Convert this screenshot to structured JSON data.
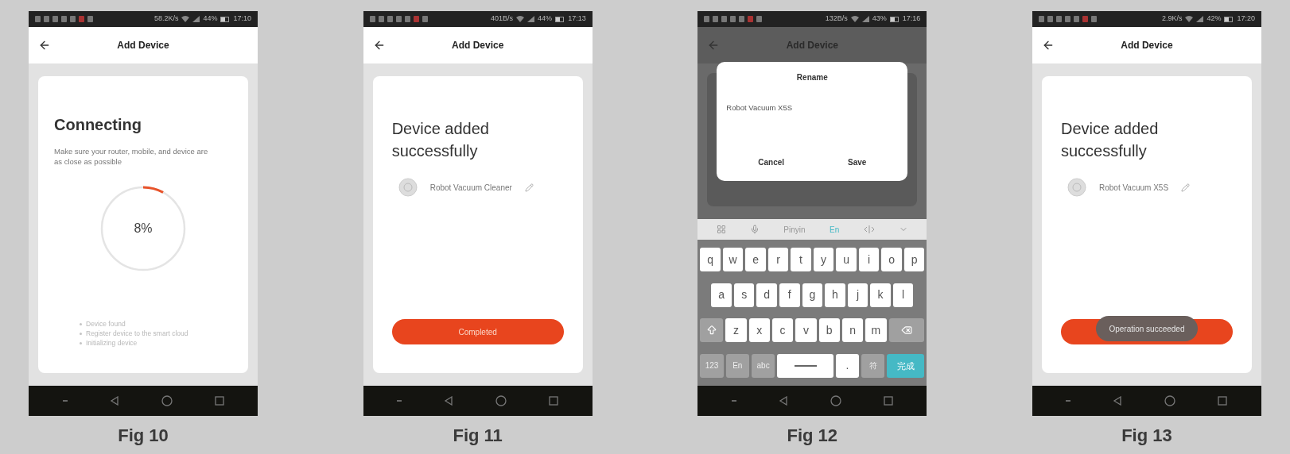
{
  "figures": [
    {
      "caption": "Fig 10",
      "status_bar": {
        "speed": "58.2K/s",
        "battery": "44%",
        "time": "17:10"
      },
      "app_bar": {
        "title": "Add Device",
        "dimmed": false
      },
      "screen": {
        "kind": "connecting",
        "title": "Connecting",
        "hint": "Make sure your router, mobile, and device are as close as possible",
        "progress": {
          "level": 0.08,
          "reading": "8%"
        },
        "steps": [
          "Device found",
          "Register device to the smart cloud",
          "Initializing device"
        ]
      }
    },
    {
      "caption": "Fig 11",
      "status_bar": {
        "speed": "401B/s",
        "battery": "44%",
        "time": "17:13"
      },
      "app_bar": {
        "title": "Add Device",
        "dimmed": false
      },
      "screen": {
        "kind": "added",
        "title": "Device added successfully",
        "device": "Robot Vacuum Cleaner",
        "button": {
          "kind": "primary",
          "label": "Completed"
        }
      }
    },
    {
      "caption": "Fig 12",
      "status_bar": {
        "speed": "132B/s",
        "battery": "43%",
        "time": "17:16"
      },
      "app_bar": {
        "title": "Add Device",
        "dimmed": true
      },
      "screen": {
        "kind": "rename",
        "dialog": {
          "title": "Rename",
          "value": "Robot Vacuum X5S",
          "buttons": [
            "Cancel",
            "Save"
          ]
        },
        "keyboard": {
          "toolbar": [
            {
              "kind": "grid"
            },
            {
              "kind": "mic"
            },
            {
              "kind": "text",
              "label": "Pinyin",
              "selected": false
            },
            {
              "kind": "text",
              "label": "En",
              "selected": true
            },
            {
              "kind": "cursor"
            },
            {
              "kind": "chevron"
            }
          ],
          "rows": [
            [
              {
                "kind": "letter",
                "label": "q"
              },
              {
                "kind": "letter",
                "label": "w"
              },
              {
                "kind": "letter",
                "label": "e"
              },
              {
                "kind": "letter",
                "label": "r"
              },
              {
                "kind": "letter",
                "label": "t"
              },
              {
                "kind": "letter",
                "label": "y"
              },
              {
                "kind": "letter",
                "label": "u"
              },
              {
                "kind": "letter",
                "label": "i"
              },
              {
                "kind": "letter",
                "label": "o"
              },
              {
                "kind": "letter",
                "label": "p"
              }
            ],
            [
              {
                "kind": "letter",
                "label": "a"
              },
              {
                "kind": "letter",
                "label": "s"
              },
              {
                "kind": "letter",
                "label": "d"
              },
              {
                "kind": "letter",
                "label": "f"
              },
              {
                "kind": "letter",
                "label": "g"
              },
              {
                "kind": "letter",
                "label": "h"
              },
              {
                "kind": "letter",
                "label": "j"
              },
              {
                "kind": "letter",
                "label": "k"
              },
              {
                "kind": "letter",
                "label": "l"
              }
            ],
            [
              {
                "kind": "shift"
              },
              {
                "kind": "letter",
                "label": "z"
              },
              {
                "kind": "letter",
                "label": "x"
              },
              {
                "kind": "letter",
                "label": "c"
              },
              {
                "kind": "letter",
                "label": "v"
              },
              {
                "kind": "letter",
                "label": "b"
              },
              {
                "kind": "letter",
                "label": "n"
              },
              {
                "kind": "letter",
                "label": "m"
              },
              {
                "kind": "backspace"
              }
            ],
            [
              {
                "kind": "function",
                "label": "123"
              },
              {
                "kind": "function",
                "label": "En"
              },
              {
                "kind": "function",
                "label": "abc"
              },
              {
                "kind": "space"
              },
              {
                "kind": "letter",
                "label": "."
              },
              {
                "kind": "function",
                "label": "符"
              },
              {
                "kind": "done",
                "label": "完成"
              }
            ]
          ]
        }
      }
    },
    {
      "caption": "Fig 13",
      "status_bar": {
        "speed": "2.9K/s",
        "battery": "42%",
        "time": "17:20"
      },
      "app_bar": {
        "title": "Add Device",
        "dimmed": false
      },
      "screen": {
        "kind": "added",
        "title": "Device added successfully",
        "device": "Robot Vacuum X5S",
        "button": {
          "kind": "primary"
        },
        "toast": "Operation succeeded"
      }
    }
  ]
}
